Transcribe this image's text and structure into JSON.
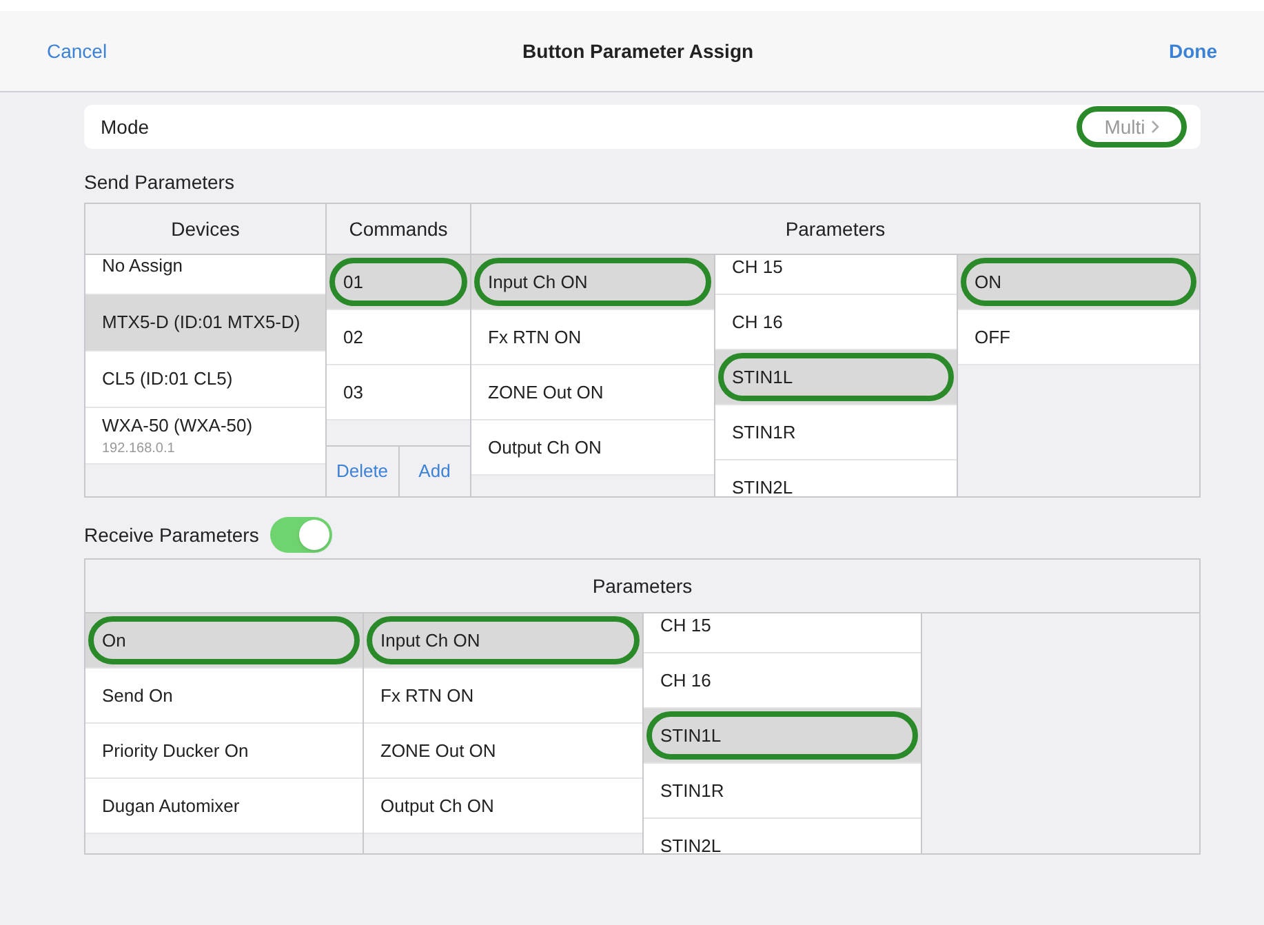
{
  "nav": {
    "cancel": "Cancel",
    "title": "Button Parameter Assign",
    "done": "Done"
  },
  "mode": {
    "label": "Mode",
    "value": "Multi",
    "highlighted": true
  },
  "send": {
    "title": "Send Parameters",
    "headers": [
      "Devices",
      "Commands",
      "Parameters"
    ],
    "devices": [
      {
        "name": "No Assign",
        "selected": false
      },
      {
        "name": "MTX5-D (ID:01 MTX5-D)",
        "selected": true
      },
      {
        "name": "CL5 (ID:01 CL5)",
        "selected": false
      },
      {
        "name": "WXA-50 (WXA-50)",
        "sub": "192.168.0.1",
        "selected": false
      }
    ],
    "commands": [
      {
        "label": "01",
        "selected": true,
        "highlighted": true
      },
      {
        "label": "02",
        "selected": false,
        "highlighted": false
      },
      {
        "label": "03",
        "selected": false,
        "highlighted": false
      }
    ],
    "buttons": [
      "Delete",
      "Add"
    ],
    "types": [
      {
        "label": "Input Ch ON",
        "selected": true,
        "highlighted": true
      },
      {
        "label": "Fx RTN ON",
        "selected": false,
        "highlighted": false
      },
      {
        "label": "ZONE Out ON",
        "selected": false,
        "highlighted": false
      },
      {
        "label": "Output Ch ON",
        "selected": false,
        "highlighted": false
      }
    ],
    "channels": [
      {
        "label": "CH 15",
        "selected": false,
        "highlighted": false
      },
      {
        "label": "CH 16",
        "selected": false,
        "highlighted": false
      },
      {
        "label": "STIN1L",
        "selected": true,
        "highlighted": true
      },
      {
        "label": "STIN1R",
        "selected": false,
        "highlighted": false
      },
      {
        "label": "STIN2L",
        "selected": false,
        "highlighted": false
      }
    ],
    "values": [
      {
        "label": "ON",
        "selected": true,
        "highlighted": true
      },
      {
        "label": "OFF",
        "selected": false,
        "highlighted": false
      }
    ]
  },
  "receive": {
    "title": "Receive Parameters",
    "on": true,
    "header": "Parameters",
    "functions": [
      {
        "label": "On",
        "selected": true,
        "highlighted": true
      },
      {
        "label": "Send On",
        "selected": false,
        "highlighted": false
      },
      {
        "label": "Priority Ducker On",
        "selected": false,
        "highlighted": false
      },
      {
        "label": "Dugan Automixer",
        "selected": false,
        "highlighted": false
      }
    ],
    "types": [
      {
        "label": "Input Ch ON",
        "selected": true,
        "highlighted": true
      },
      {
        "label": "Fx RTN ON",
        "selected": false,
        "highlighted": false
      },
      {
        "label": "ZONE Out ON",
        "selected": false,
        "highlighted": false
      },
      {
        "label": "Output Ch ON",
        "selected": false,
        "highlighted": false
      }
    ],
    "channels": [
      {
        "label": "CH 15",
        "selected": false,
        "highlighted": false
      },
      {
        "label": "CH 16",
        "selected": false,
        "highlighted": false
      },
      {
        "label": "STIN1L",
        "selected": true,
        "highlighted": true
      },
      {
        "label": "STIN1R",
        "selected": false,
        "highlighted": false
      },
      {
        "label": "STIN2L",
        "selected": false,
        "highlighted": false
      }
    ]
  }
}
